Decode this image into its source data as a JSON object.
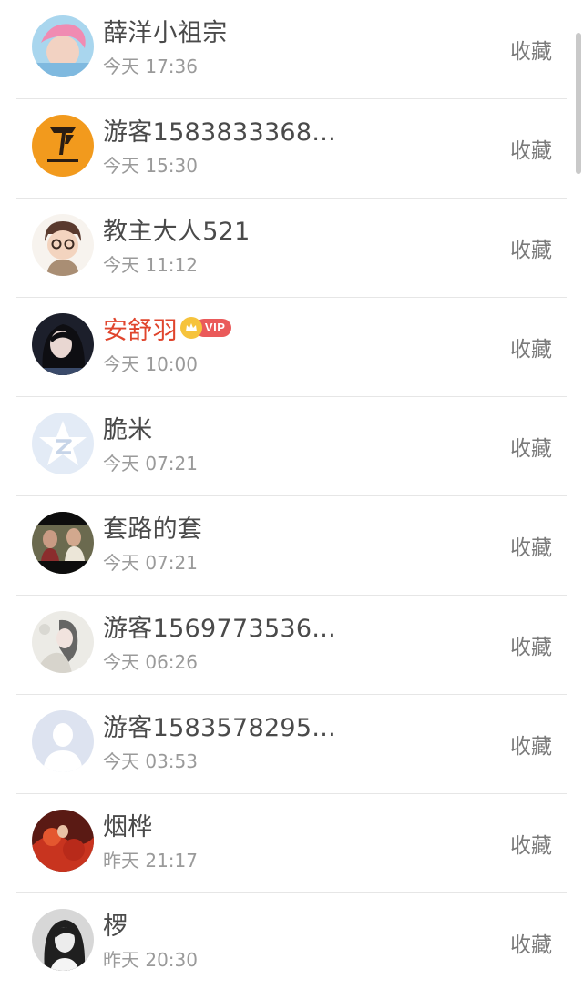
{
  "action_label": "收藏",
  "vip_label": "VIP",
  "users": [
    {
      "name": "薛洋小祖宗",
      "time": "今天 17:36",
      "avatar": "pink-hair-avatar",
      "vip": false
    },
    {
      "name": "游客1583833368...",
      "time": "今天 15:30",
      "avatar": "tfboys-logo-avatar",
      "vip": false
    },
    {
      "name": "教主大人521",
      "time": "今天 11:12",
      "avatar": "cartoon-boy-avatar",
      "vip": false
    },
    {
      "name": "安舒羽",
      "time": "今天 10:00",
      "avatar": "dark-hair-girl-avatar",
      "vip": true
    },
    {
      "name": "脆米",
      "time": "今天 07:21",
      "avatar": "default-star-avatar",
      "vip": false
    },
    {
      "name": "套路的套",
      "time": "今天 07:21",
      "avatar": "movie-couple-avatar",
      "vip": false
    },
    {
      "name": "游客1569773536...",
      "time": "今天 06:26",
      "avatar": "ink-painting-girl-avatar",
      "vip": false
    },
    {
      "name": "游客1583578295...",
      "time": "今天 03:53",
      "avatar": "default-person-avatar",
      "vip": false
    },
    {
      "name": "烟桦",
      "time": "昨天 21:17",
      "avatar": "red-scene-avatar",
      "vip": false
    },
    {
      "name": "椤",
      "time": "昨天 20:30",
      "avatar": "bw-girl-avatar",
      "vip": false
    }
  ]
}
